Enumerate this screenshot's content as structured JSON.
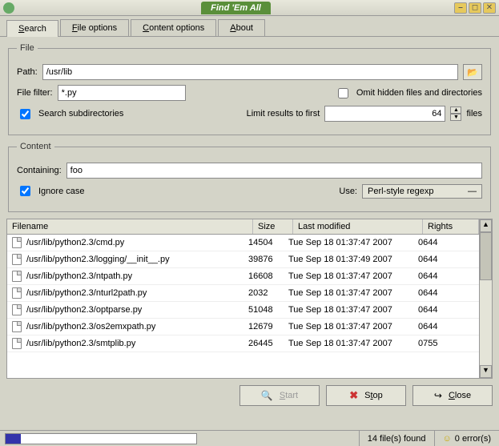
{
  "window": {
    "title": "Find 'Em All"
  },
  "tabs": [
    {
      "label": "Search",
      "accel": "S",
      "active": true
    },
    {
      "label": "File options",
      "accel": "F"
    },
    {
      "label": "Content options",
      "accel": "C"
    },
    {
      "label": "About",
      "accel": "A"
    }
  ],
  "file": {
    "legend": "File",
    "path_label": "Path:",
    "path_value": "/usr/lib",
    "filter_label": "File filter:",
    "filter_value": "*.py",
    "omit_hidden_label": "Omit hidden files and directories",
    "omit_hidden_checked": false,
    "subdirs_label": "Search subdirectories",
    "subdirs_checked": true,
    "limit_label": "Limit results to first",
    "limit_value": "64",
    "limit_suffix": "files"
  },
  "content": {
    "legend": "Content",
    "containing_label": "Containing:",
    "containing_value": "foo",
    "ignore_case_label": "Ignore case",
    "ignore_case_checked": true,
    "use_label": "Use:",
    "regexp_option": "Perl-style regexp"
  },
  "results": {
    "headers": {
      "filename": "Filename",
      "size": "Size",
      "modified": "Last modified",
      "rights": "Rights"
    },
    "rows": [
      {
        "name": "/usr/lib/python2.3/cmd.py",
        "size": "14504",
        "mod": "Tue Sep 18 01:37:47 2007",
        "rights": "0644"
      },
      {
        "name": "/usr/lib/python2.3/logging/__init__.py",
        "size": "39876",
        "mod": "Tue Sep 18 01:37:49 2007",
        "rights": "0644"
      },
      {
        "name": "/usr/lib/python2.3/ntpath.py",
        "size": "16608",
        "mod": "Tue Sep 18 01:37:47 2007",
        "rights": "0644"
      },
      {
        "name": "/usr/lib/python2.3/nturl2path.py",
        "size": "2032",
        "mod": "Tue Sep 18 01:37:47 2007",
        "rights": "0644"
      },
      {
        "name": "/usr/lib/python2.3/optparse.py",
        "size": "51048",
        "mod": "Tue Sep 18 01:37:47 2007",
        "rights": "0644"
      },
      {
        "name": "/usr/lib/python2.3/os2emxpath.py",
        "size": "12679",
        "mod": "Tue Sep 18 01:37:47 2007",
        "rights": "0644"
      },
      {
        "name": "/usr/lib/python2.3/smtplib.py",
        "size": "26445",
        "mod": "Tue Sep 18 01:37:47 2007",
        "rights": "0755"
      }
    ]
  },
  "buttons": {
    "start": "Start",
    "stop": "Stop",
    "close": "Close"
  },
  "status": {
    "found": "14 file(s) found",
    "errors": "0 error(s)"
  }
}
